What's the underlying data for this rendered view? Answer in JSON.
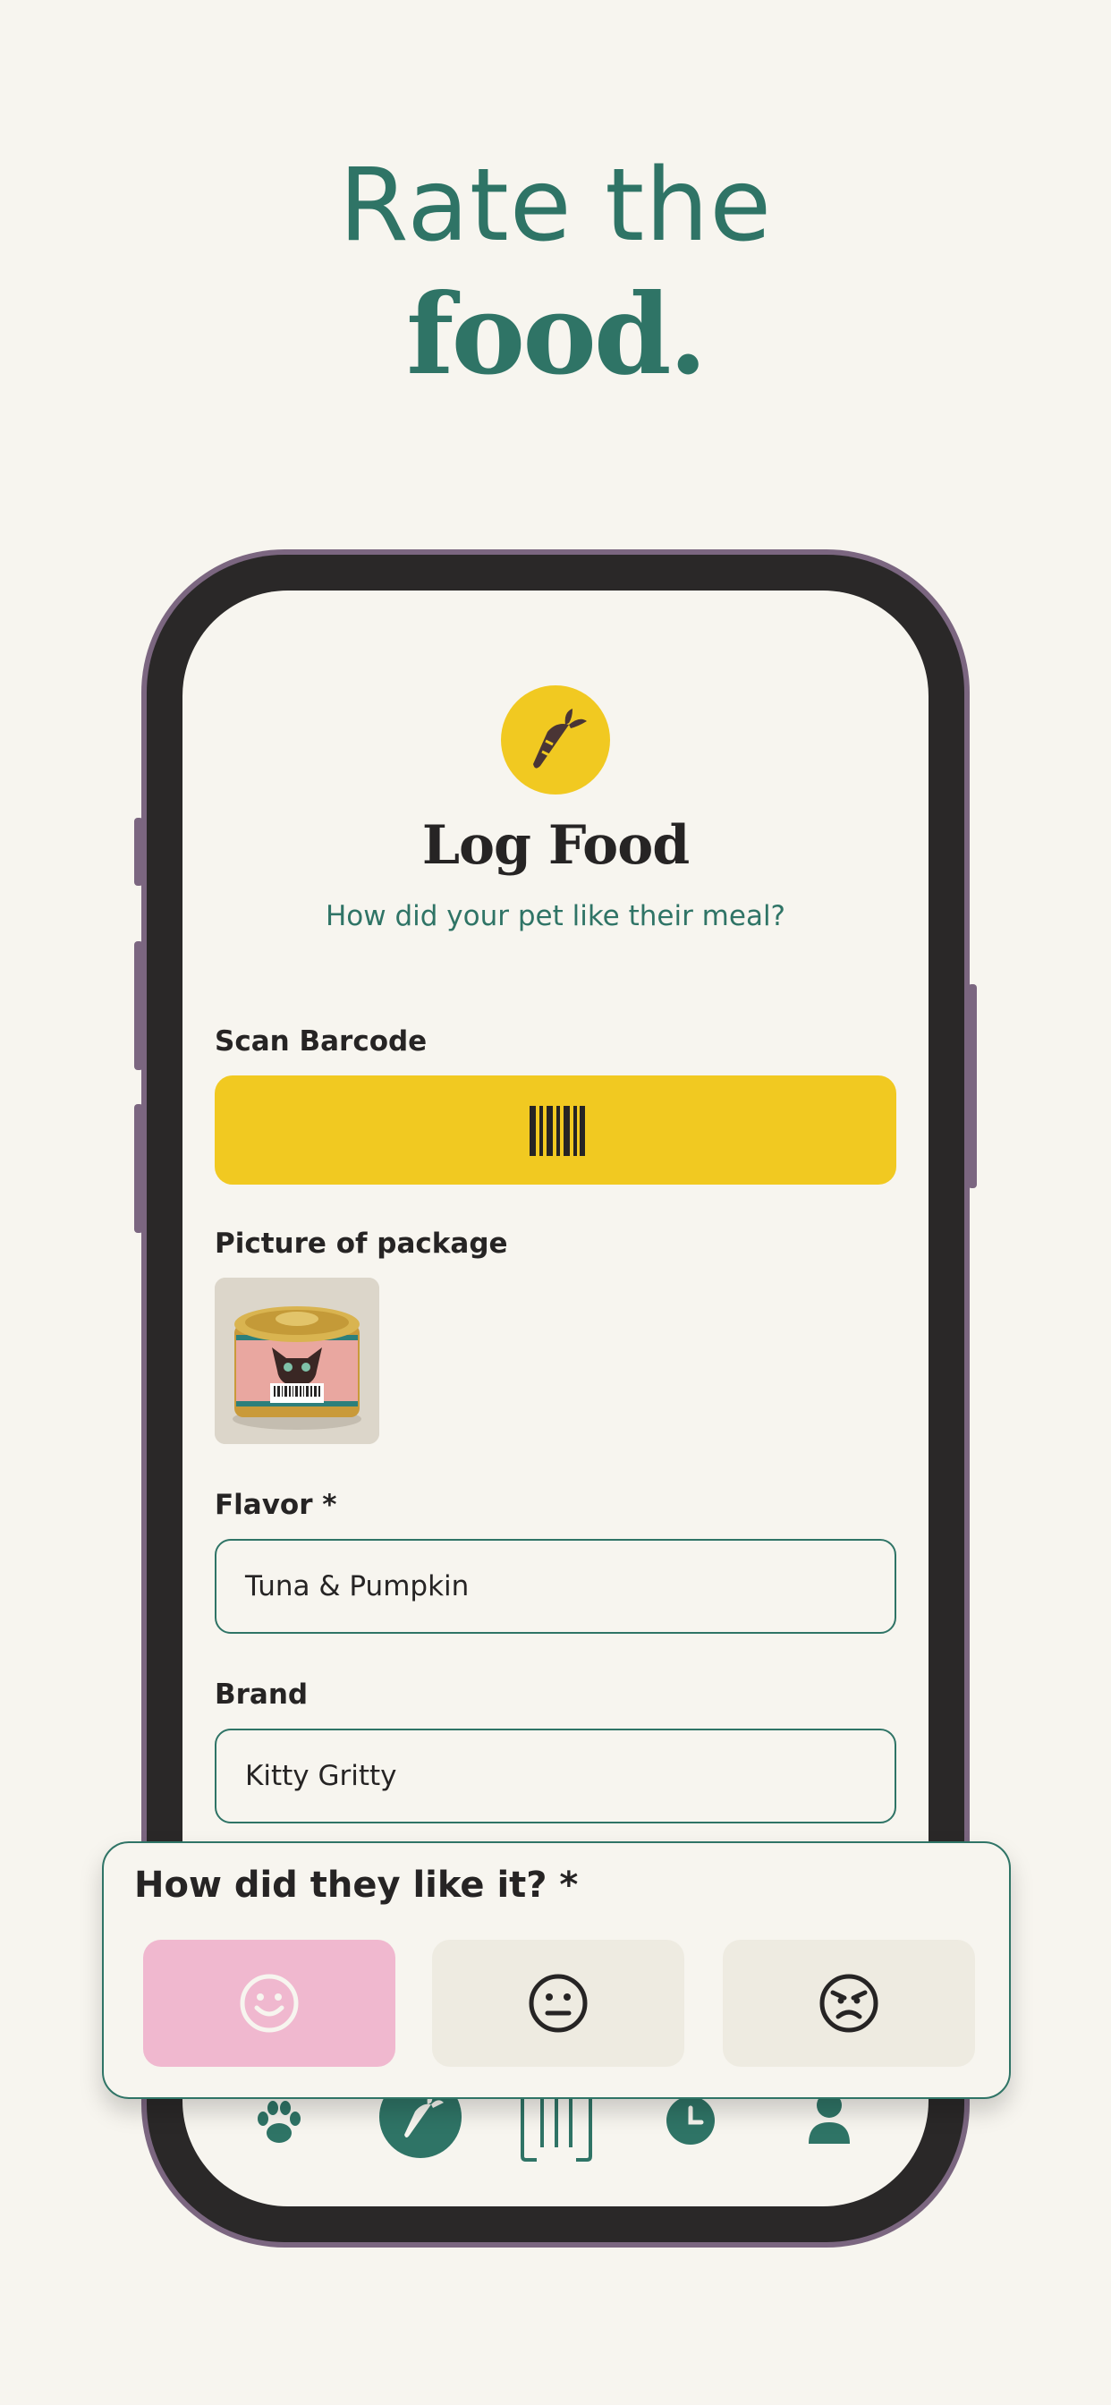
{
  "headline": {
    "line1": "Rate the",
    "line2": "food."
  },
  "screen": {
    "app_icon": "carrot-icon",
    "title": "Log Food",
    "subtitle": "How did your pet like their meal?",
    "scan": {
      "label": "Scan Barcode",
      "icon": "barcode-icon"
    },
    "picture": {
      "label": "Picture of package",
      "image": "cat-food-can-photo"
    },
    "flavor": {
      "label": "Flavor *",
      "value": "Tuna & Pumpkin"
    },
    "brand": {
      "label": "Brand",
      "value": "Kitty Gritty"
    },
    "bottom_nav": [
      "paw-icon",
      "carrot-icon",
      "barcode-scan-icon",
      "clock-icon",
      "user-icon"
    ]
  },
  "rating": {
    "title": "How did they like it? *",
    "options": [
      {
        "name": "happy",
        "icon": "smile-icon",
        "selected": true
      },
      {
        "name": "neutral",
        "icon": "neutral-face-icon",
        "selected": false
      },
      {
        "name": "angry",
        "icon": "angry-face-icon",
        "selected": false
      }
    ]
  },
  "colors": {
    "background": "#f7f5ef",
    "accent_teal": "#2f7466",
    "accent_yellow": "#f1c921",
    "selected_pink": "#f0b8cf",
    "option_bg": "#eeebe1",
    "phone_frame": "#7b6680",
    "text_dark": "#262424"
  }
}
